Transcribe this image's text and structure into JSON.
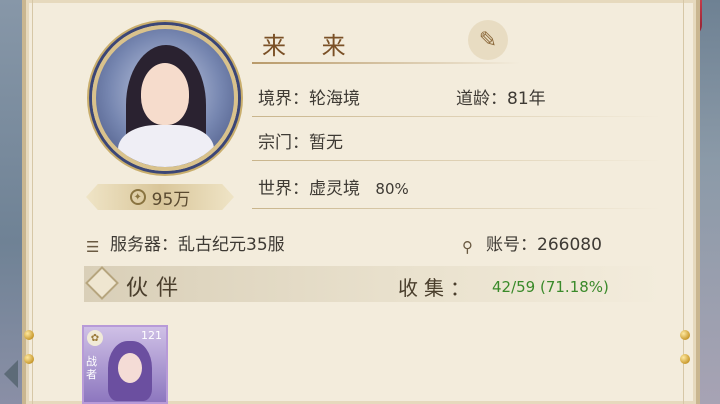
{
  "profile": {
    "name": "来 来",
    "power": "95万",
    "realm_label": "境界：",
    "realm_value": "轮海境",
    "age_label": "道龄：",
    "age_value": "81年",
    "sect_label": "宗门：",
    "sect_value": "暂无",
    "world_label": "世界：",
    "world_value": "虚灵境",
    "world_percent": "80%",
    "server_label": "服务器：",
    "server_value": "乱古纪元35服",
    "account_label": "账号：",
    "account_value": "266080"
  },
  "partners": {
    "title": "伙伴",
    "collect_label": "收集：",
    "collect_value": "42/59 (71.18%)",
    "cards": [
      {
        "level": "121",
        "role": "战者"
      }
    ]
  },
  "colors": {
    "collect_green": "#3a8a2a",
    "name_brown": "#7a5026",
    "panel_bg": "#f3ecdc"
  },
  "icons": [
    "brush-icon",
    "power-icon",
    "server-icon",
    "account-icon",
    "diamond-icon"
  ]
}
